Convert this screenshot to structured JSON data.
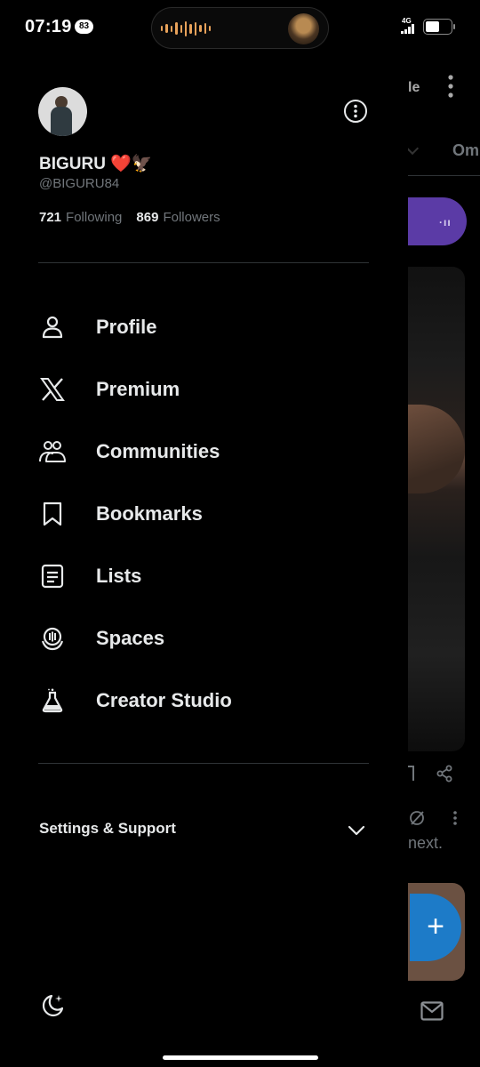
{
  "status_bar": {
    "time": "07:19",
    "notification_count": "83",
    "network": "4G",
    "battery_level": 0.55
  },
  "profile": {
    "display_name": "BIGURU ❤️🦅",
    "handle": "@BIGURU84",
    "following_count": "721",
    "following_label": "Following",
    "followers_count": "869",
    "followers_label": "Followers"
  },
  "menu": [
    {
      "label": "Profile",
      "icon": "person-icon"
    },
    {
      "label": "Premium",
      "icon": "x-logo-icon"
    },
    {
      "label": "Communities",
      "icon": "communities-icon"
    },
    {
      "label": "Bookmarks",
      "icon": "bookmark-icon"
    },
    {
      "label": "Lists",
      "icon": "list-icon"
    },
    {
      "label": "Spaces",
      "icon": "spaces-icon"
    },
    {
      "label": "Creator Studio",
      "icon": "flask-icon"
    }
  ],
  "settings": {
    "label": "Settings & Support",
    "icon": "chevron-down-icon"
  },
  "footer": {
    "icon": "moon-icon"
  },
  "background_feed": {
    "title_fragment": "le",
    "tab_fragment": "Om",
    "text_fragment": "next.",
    "fab_symbol": "+"
  },
  "colors": {
    "background": "#000000",
    "text_primary": "#e7e9ea",
    "text_secondary": "#71767b",
    "divider": "#2f3336",
    "spaces_pill": "#5b3ba6",
    "fab": "#1d7bc8"
  }
}
